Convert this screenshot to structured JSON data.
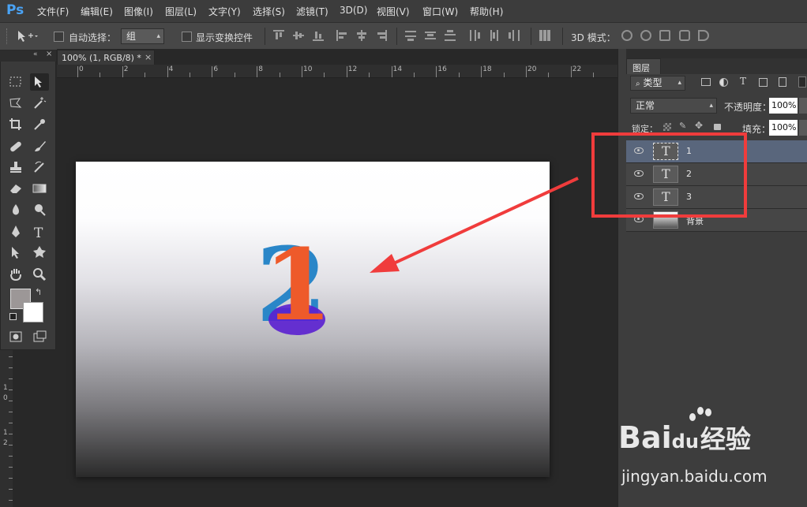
{
  "app": {
    "logo": "Ps"
  },
  "menu": [
    "文件(F)",
    "编辑(E)",
    "图像(I)",
    "图层(L)",
    "文字(Y)",
    "选择(S)",
    "滤镜(T)",
    "3D(D)",
    "视图(V)",
    "窗口(W)",
    "帮助(H)"
  ],
  "options": {
    "auto_select_label": "自动选择：",
    "auto_select_value": "组",
    "show_transform_label": "显示变换控件",
    "mode_3d_label": "3D 模式："
  },
  "document": {
    "tab_title": "100% (1, RGB/8) *",
    "ruler_h": [
      "0",
      "2",
      "4",
      "6",
      "8",
      "10",
      "12",
      "14",
      "16",
      "18",
      "20",
      "22"
    ],
    "ruler_v": [
      "1",
      "0",
      "1",
      "2"
    ],
    "canvas_glyphs": {
      "back": "2",
      "front": "1"
    }
  },
  "layers_panel": {
    "tab_label": "图层",
    "filter_label": "类型",
    "blend_mode": "正常",
    "opacity_label": "不透明度：",
    "opacity_value": "100%",
    "lock_label": "锁定：",
    "fill_label": "填充：",
    "fill_value": "100%",
    "thumb_glyph": "T",
    "layers": [
      {
        "name": "1",
        "type": "text",
        "selected": true
      },
      {
        "name": "2",
        "type": "text",
        "selected": false
      },
      {
        "name": "3",
        "type": "text",
        "selected": false
      },
      {
        "name": "背景",
        "type": "image",
        "selected": false
      }
    ]
  },
  "annotation": {
    "color": "#f03c3c"
  },
  "watermark": {
    "brand": "Bai",
    "brand_mid": "du",
    "cn": "经验",
    "url": "jingyan.baidu.com"
  },
  "colors": {
    "accent_blue": "#4aa3f5",
    "digit_blue": "#2a86c8",
    "digit_purple": "#5a1fd0",
    "digit_orange": "#ee5a2a"
  }
}
